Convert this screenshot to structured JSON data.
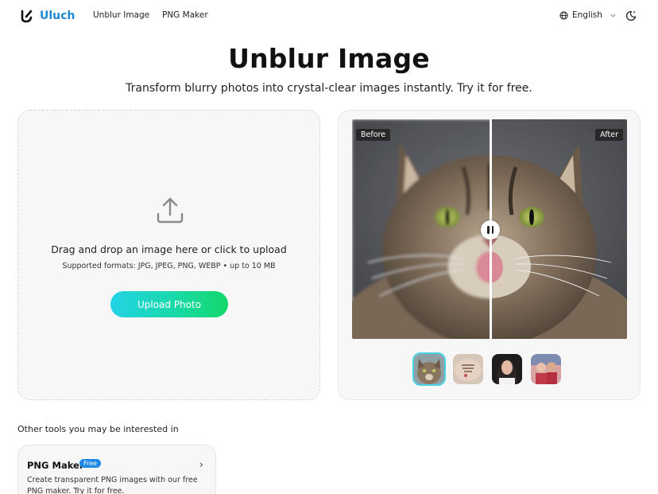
{
  "header": {
    "logo_text": "Uluch",
    "nav": [
      "Unblur Image",
      "PNG Maker"
    ],
    "language": "English"
  },
  "hero": {
    "title": "Unblur Image",
    "subtitle": "Transform blurry photos into crystal-clear images instantly. Try it for free."
  },
  "upload": {
    "main_text": "Drag and drop an image here or click to upload",
    "formats_text": "Supported formats: JPG, JPEG, PNG, WEBP • up to 10 MB",
    "button_label": "Upload Photo"
  },
  "preview": {
    "before_label": "Before",
    "after_label": "After",
    "divider_position_percent": 50,
    "samples": [
      "cat",
      "tattoo",
      "woman-portrait",
      "couple"
    ],
    "selected_sample": 0
  },
  "other_tools": {
    "heading": "Other tools you may be interested in",
    "cards": [
      {
        "name": "PNG Maker",
        "badge": "Free",
        "description": "Create transparent PNG images with our free PNG maker. Try it for free."
      }
    ]
  },
  "colors": {
    "brand": "#1e88d6",
    "button_gradient_start": "#22d3e6",
    "button_gradient_end": "#12d86a",
    "badge": "#1e88e5",
    "thumb_selected_border": "#49d4e6"
  },
  "icons": [
    "logo-mark-icon",
    "globe-icon",
    "chevron-down-icon",
    "theme-toggle-icon",
    "upload-icon",
    "pause-handle-icon",
    "chevron-right-icon"
  ]
}
